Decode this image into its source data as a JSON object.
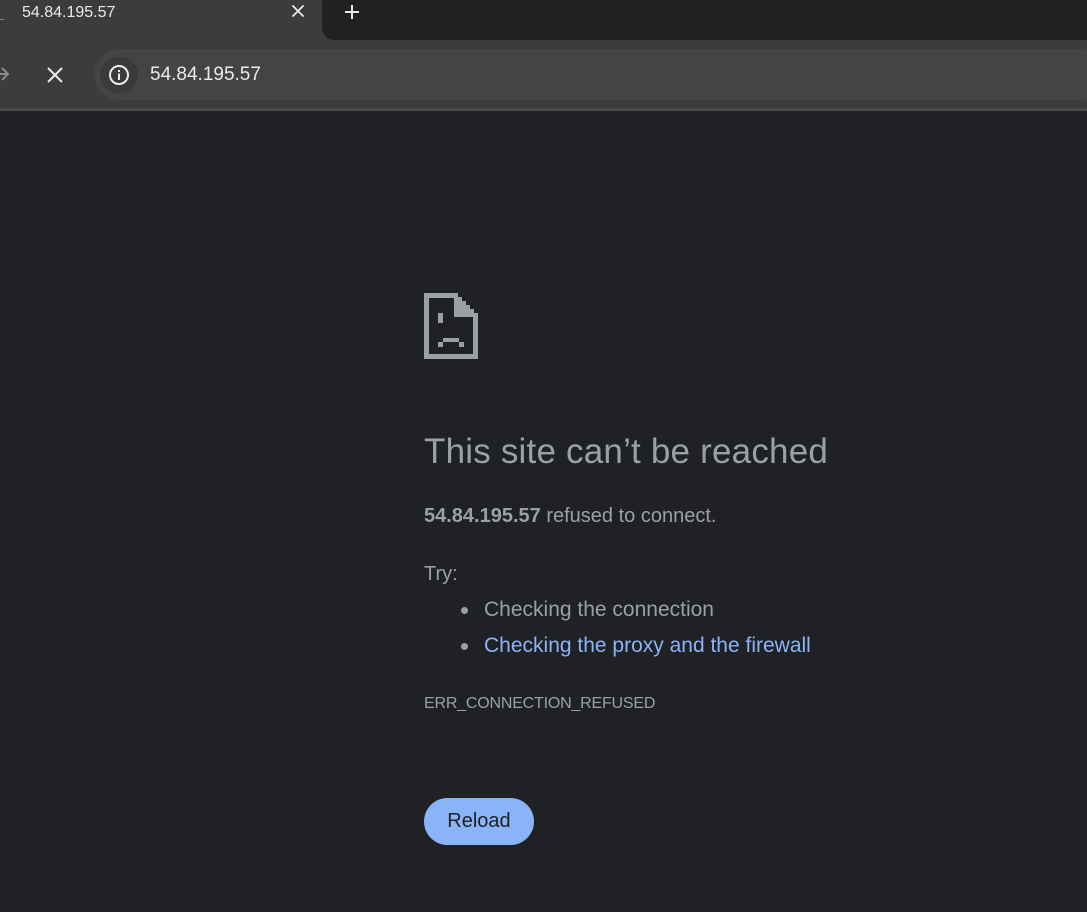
{
  "browser": {
    "tab": {
      "title": "54.84.195.57",
      "close_icon": "close-icon"
    },
    "new_tab_icon": "plus-icon",
    "toolbar": {
      "forward_icon": "arrow-right-icon",
      "stop_icon": "close-icon",
      "site_info_icon": "info-icon",
      "url": "54.84.195.57"
    }
  },
  "error_page": {
    "icon": "sad-document-icon",
    "heading": "This site can’t be reached",
    "host": "54.84.195.57",
    "summary_suffix": " refused to connect.",
    "try_label": "Try:",
    "suggestions": [
      {
        "text": "Checking the connection",
        "is_link": false
      },
      {
        "text": "Checking the proxy and the firewall",
        "is_link": true
      }
    ],
    "error_code": "ERR_CONNECTION_REFUSED",
    "reload_label": "Reload"
  },
  "colors": {
    "page_bg": "#202124",
    "text": "#9aa0a6",
    "link": "#8ab4f8",
    "button_bg": "#8ab4f8",
    "chrome_bg": "#3c3c3c",
    "tabstrip_bg": "#202120"
  }
}
